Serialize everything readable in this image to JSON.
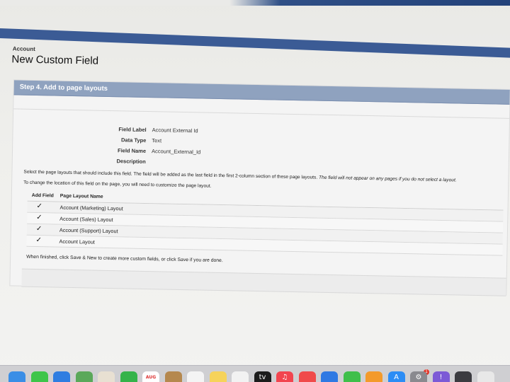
{
  "header": {
    "object_name": "Account",
    "page_title": "New Custom Field"
  },
  "step": {
    "title": "Step 4. Add to page layouts"
  },
  "field_details": [
    {
      "label": "Field Label",
      "value": "Account External Id"
    },
    {
      "label": "Data Type",
      "value": "Text"
    },
    {
      "label": "Field Name",
      "value": "Account_External_Id"
    },
    {
      "label": "Description",
      "value": ""
    }
  ],
  "instructions": {
    "line1": "Select the page layouts that should include this field. The field will be added as the last field in the first 2-column section of these page layouts.",
    "line1_italic": "The field will not appear on any pages if you do not select a layout.",
    "line2": "To change the location of this field on the page, you will need to customize the page layout."
  },
  "layouts_table": {
    "columns": [
      "Add Field",
      "Page Layout Name"
    ],
    "rows": [
      {
        "checked": "✓",
        "name": "Account (Marketing) Layout"
      },
      {
        "checked": "✓",
        "name": "Account (Sales) Layout"
      },
      {
        "checked": "✓",
        "name": "Account (Support) Layout"
      },
      {
        "checked": "✓",
        "name": "Account Layout"
      }
    ]
  },
  "footer": {
    "note": "When finished, click Save & New to create more custom fields, or click Save if you are done."
  },
  "dock": {
    "items": [
      {
        "icon": "finder-icon",
        "color": "#3a8ee6",
        "glyph": ""
      },
      {
        "icon": "messages-icon",
        "color": "#3ec54a",
        "glyph": ""
      },
      {
        "icon": "mail-icon",
        "color": "#2f7de1",
        "glyph": ""
      },
      {
        "icon": "maps-icon",
        "color": "#5aa85a",
        "glyph": ""
      },
      {
        "icon": "photos-icon",
        "color": "#e8e0d2",
        "glyph": ""
      },
      {
        "icon": "facetime-icon",
        "color": "#34b34a",
        "glyph": ""
      },
      {
        "icon": "calendar-icon",
        "color": "#ffffff",
        "glyph": "AUG"
      },
      {
        "icon": "contacts-icon",
        "color": "#b5884e",
        "glyph": ""
      },
      {
        "icon": "reminders-icon",
        "color": "#f4f4f4",
        "glyph": ""
      },
      {
        "icon": "notes-icon",
        "color": "#f6d35a",
        "glyph": ""
      },
      {
        "icon": "freeform-icon",
        "color": "#f2f2f2",
        "glyph": ""
      },
      {
        "icon": "tv-icon",
        "color": "#1c1c1c",
        "glyph": "tv"
      },
      {
        "icon": "music-icon",
        "color": "#f2444f",
        "glyph": "♫"
      },
      {
        "icon": "news-icon",
        "color": "#f04a4a",
        "glyph": ""
      },
      {
        "icon": "keynote-icon",
        "color": "#2f79e3",
        "glyph": ""
      },
      {
        "icon": "numbers-icon",
        "color": "#3fbf4a",
        "glyph": ""
      },
      {
        "icon": "pages-icon",
        "color": "#f39a2b",
        "glyph": ""
      },
      {
        "icon": "app-store-icon",
        "color": "#2c8df5",
        "glyph": "A"
      },
      {
        "icon": "system-settings-icon",
        "color": "#8a8a8f",
        "glyph": "⚙"
      },
      {
        "icon": "feedback-icon",
        "color": "#7c5ad6",
        "glyph": "!"
      },
      {
        "icon": "iphone-mirroring-icon",
        "color": "#3b3b40",
        "glyph": ""
      },
      {
        "icon": "chrome-icon",
        "color": "#e8e8e8",
        "glyph": ""
      }
    ],
    "badge": "1"
  }
}
